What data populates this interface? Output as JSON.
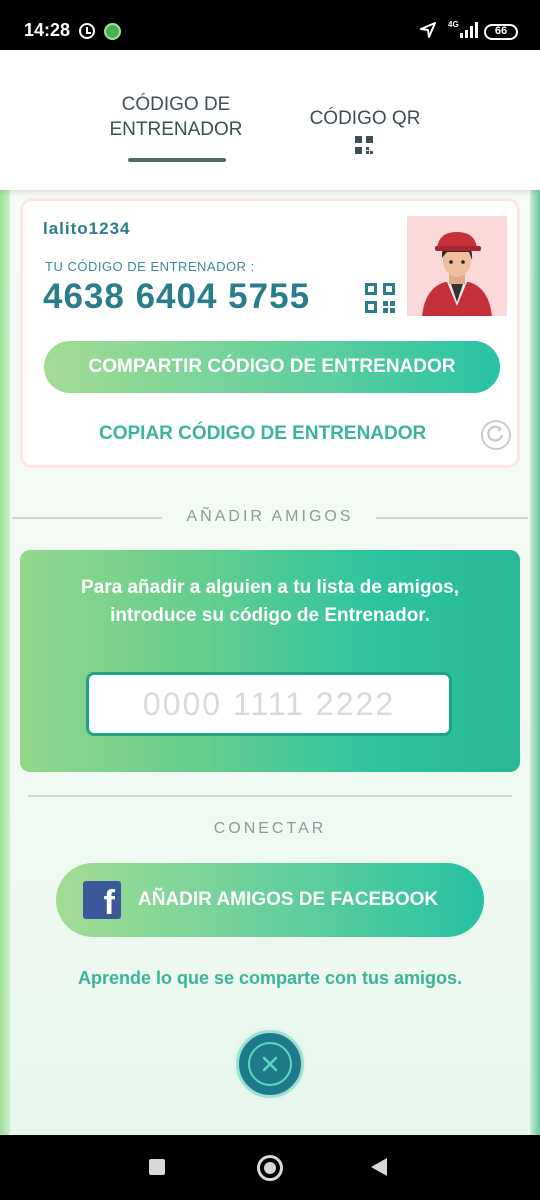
{
  "status_bar": {
    "time": "14:28",
    "network": "4G",
    "battery": "66"
  },
  "tabs": [
    {
      "label": "CÓDIGO DE ENTRENADOR",
      "active": true
    },
    {
      "label": "CÓDIGO QR",
      "active": false
    }
  ],
  "trainer": {
    "username": "lalito1234",
    "code_label": "TU CÓDIGO DE ENTRENADOR :",
    "code": "4638 6404 5755",
    "share_button": "COMPARTIR CÓDIGO DE ENTRENADOR",
    "copy_link": "COPIAR CÓDIGO DE ENTRENADOR"
  },
  "add_friends": {
    "section_title": "AÑADIR AMIGOS",
    "instructions": "Para añadir a alguien a tu lista de amigos, introduce su código de Entrenador.",
    "input_placeholder": "0000 1111 2222"
  },
  "connect": {
    "section_title": "CONECTAR",
    "facebook_button": "AÑADIR AMIGOS DE FACEBOOK",
    "learn_link": "Aprende lo que se comparte con tus amigos."
  },
  "colors": {
    "teal_text": "#2a7d8a",
    "green_link": "#3bb49b",
    "facebook_blue": "#3b5998",
    "close_button": "#1e7a8a"
  },
  "icons": {
    "facebook": "facebook-icon",
    "close": "close-icon",
    "qr": "qr-code-icon",
    "refresh": "refresh-icon"
  }
}
